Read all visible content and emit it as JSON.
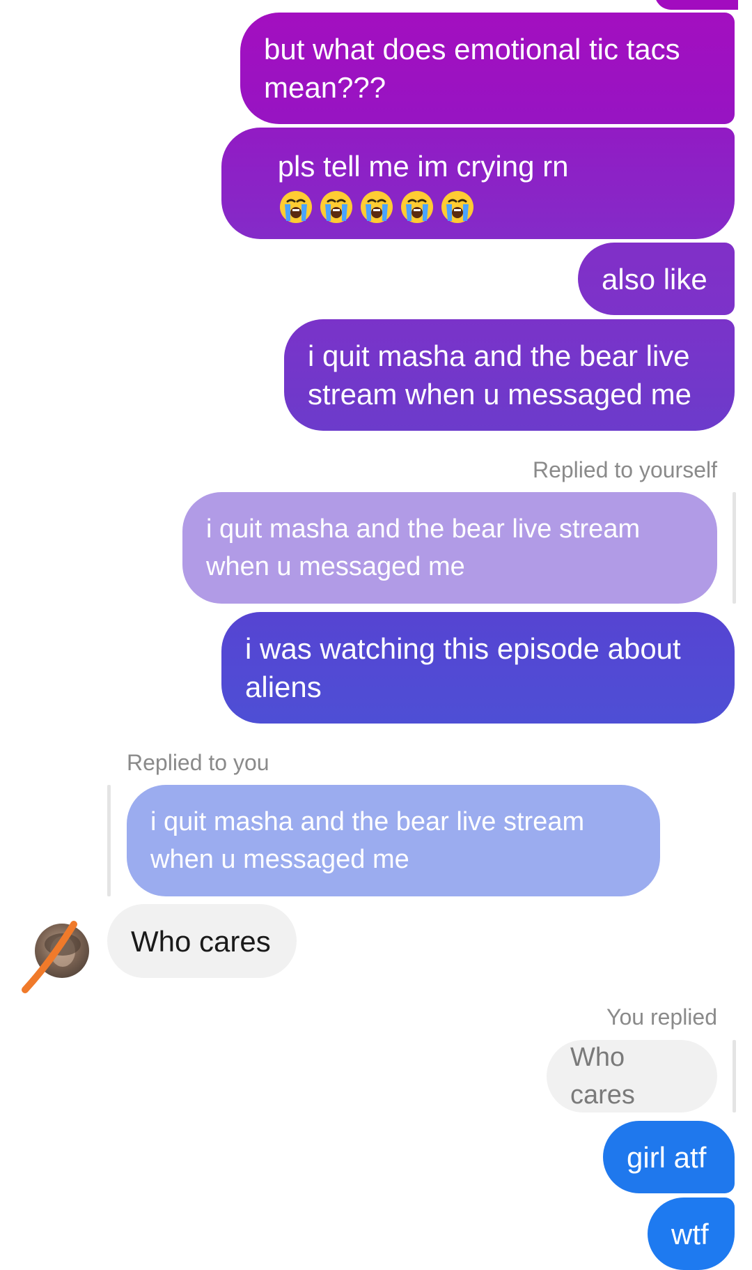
{
  "messages": {
    "m1": "but what does emotional tic tacs mean???",
    "m2_text": "pls tell me im crying rn",
    "m2_emoji": "loudly-crying-face",
    "m2_emoji_count": 5,
    "m3": "also like",
    "m4": "i quit masha and the bear live stream when u messaged me",
    "reply1_label": "Replied to yourself",
    "reply1_quote": "i quit masha and the bear live stream when u messaged me",
    "m5": "i was watching this episode about aliens",
    "reply2_label": "Replied to you",
    "reply2_quote": "i quit masha and the bear live stream when u messaged me",
    "m6": "Who cares",
    "reply3_label": "You replied",
    "reply3_quote": "Who cares",
    "m7": "girl atf",
    "m8": "wtf"
  },
  "colors": {
    "gradient_top": "#a30fc0",
    "gradient_mid": "#7d2fc9",
    "gradient_bottom": "#1e7af0",
    "incoming_bg": "#f1f1f1",
    "quote_self": "#b19be6",
    "quote_other": "#9bacef"
  },
  "icons": {
    "avatar": "avatar",
    "redaction": "orange-scribble"
  }
}
